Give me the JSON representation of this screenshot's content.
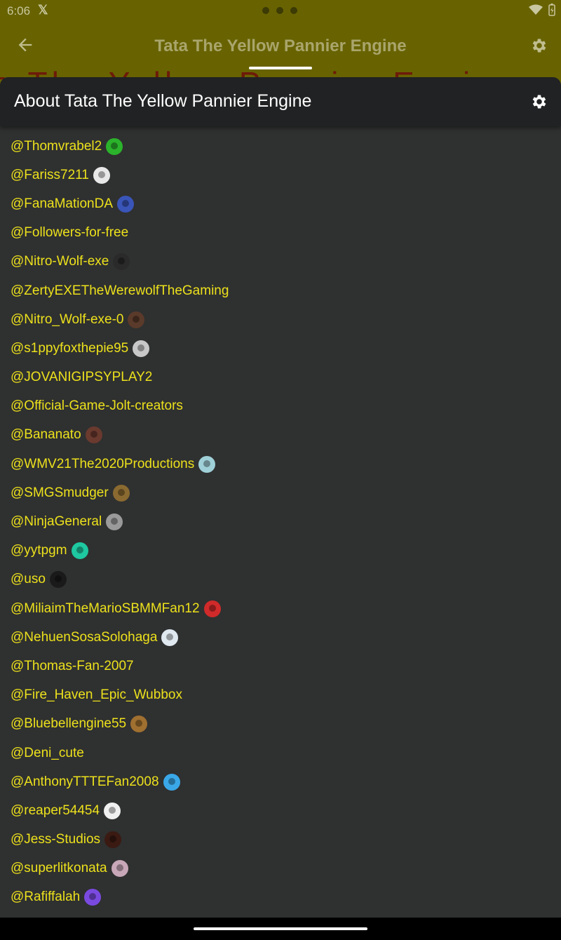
{
  "status_bar": {
    "time": "6:06",
    "app_glyph": "𝕏"
  },
  "app_header": {
    "title": "Tata The Yellow Pannier Engine",
    "banner_text": "a The Yellow Pannier Engi"
  },
  "sheet": {
    "title": "About Tata The Yellow Pannier Engine"
  },
  "colors": {
    "accent_text": "#ece11c",
    "sheet_background": "#2f3030",
    "sheet_header": "#212223",
    "dimmed_header": "#686300"
  },
  "followers": [
    {
      "name": "@Thomvrabel2",
      "avatar": "#2bb32b"
    },
    {
      "name": "@Fariss7211",
      "avatar": "#e8e8e8"
    },
    {
      "name": "@FanaMationDA",
      "avatar": "#3a55b8"
    },
    {
      "name": "@Followers-for-free",
      "avatar": null
    },
    {
      "name": "@Nitro-Wolf-exe",
      "avatar": "#2a2a2a"
    },
    {
      "name": "@ZertyEXETheWerewolfTheGaming",
      "avatar": null
    },
    {
      "name": "@Nitro_Wolf-exe-0",
      "avatar": "#5a3a2a"
    },
    {
      "name": "@s1ppyfoxthepie95",
      "avatar": "#c8c8c8"
    },
    {
      "name": "@JOVANIGIPSYPLAY2",
      "avatar": null
    },
    {
      "name": "@Official-Game-Jolt-creators",
      "avatar": null
    },
    {
      "name": "@Bananato",
      "avatar": "#6a3a2e"
    },
    {
      "name": "@WMV21The2020Productions",
      "avatar": "#9fd0d8"
    },
    {
      "name": "@SMGSmudger",
      "avatar": "#8a6a30"
    },
    {
      "name": "@NinjaGeneral",
      "avatar": "#9a9a9a"
    },
    {
      "name": "@yytpgm",
      "avatar": "#1ec8a0"
    },
    {
      "name": "@uso",
      "avatar": "#1a1a1a"
    },
    {
      "name": "@MiliaimTheMarioSBMMFan12",
      "avatar": "#d02a2a"
    },
    {
      "name": "@NehuenSosaSolohaga",
      "avatar": "#e0e8f0"
    },
    {
      "name": "@Thomas-Fan-2007",
      "avatar": null
    },
    {
      "name": "@Fire_Haven_Epic_Wubbox",
      "avatar": null
    },
    {
      "name": "@Bluebellengine55",
      "avatar": "#a07030"
    },
    {
      "name": "@Deni_cute",
      "avatar": null
    },
    {
      "name": "@AnthonyTTTEFan2008",
      "avatar": "#3aa8e8"
    },
    {
      "name": "@reaper54454",
      "avatar": "#f0f0f0"
    },
    {
      "name": "@Jess-Studios",
      "avatar": "#3a1a12"
    },
    {
      "name": "@superlitkonata",
      "avatar": "#c8a8b8"
    },
    {
      "name": "@Rafiffalah",
      "avatar": "#7a4ae0"
    }
  ]
}
